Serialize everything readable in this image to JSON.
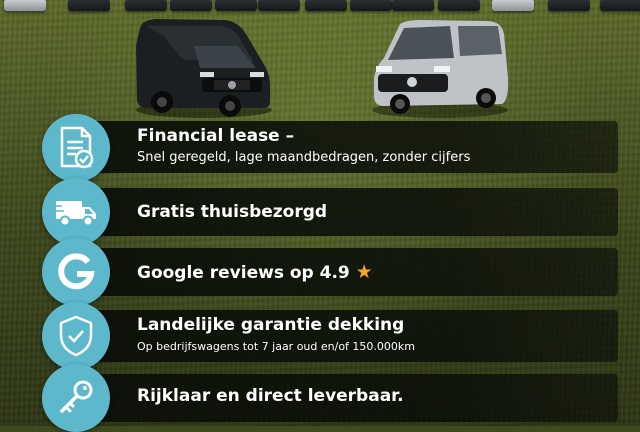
{
  "colors": {
    "icon_circle": "#5db8cb",
    "band": "#0a0e08",
    "star": "#f6a623",
    "grass": "#4e5b23"
  },
  "features": [
    {
      "icon": "contract-document-icon",
      "title": "Financial lease –",
      "subtitle": "Snel geregeld, lage maandbedragen, zonder cijfers"
    },
    {
      "icon": "delivery-truck-icon",
      "title": "Gratis thuisbezorgd"
    },
    {
      "icon": "google-g-icon",
      "title": "Google reviews op 4.9",
      "star": "★"
    },
    {
      "icon": "shield-check-icon",
      "title": "Landelijke garantie dekking",
      "subtitle": "Op bedrijfswagens tot 7 jaar oud en/of 150.000km"
    },
    {
      "icon": "key-icon",
      "title": "Rijklaar en direct leverbaar."
    }
  ]
}
